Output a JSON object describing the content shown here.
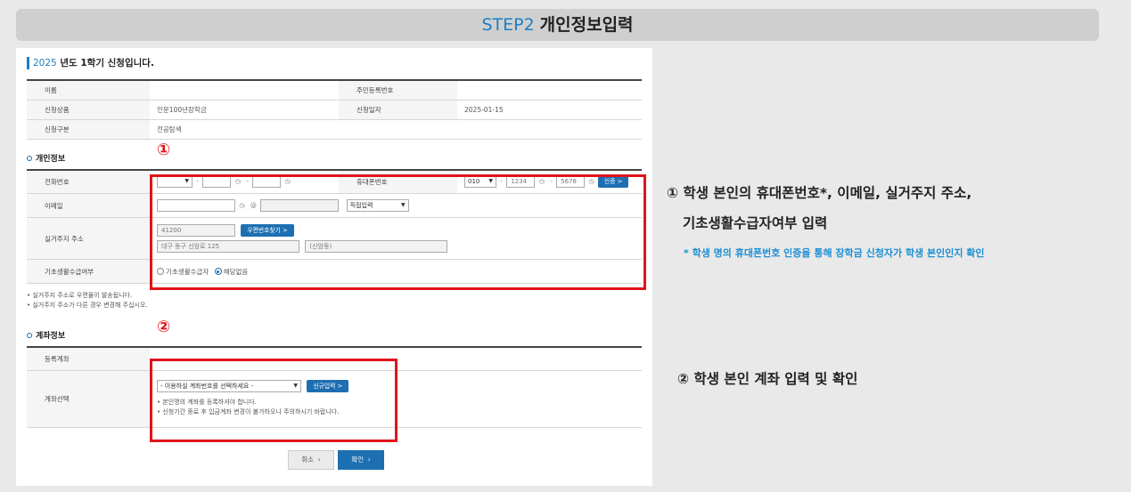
{
  "step": {
    "number": "STEP2",
    "title": "개인정보입력"
  },
  "semester": {
    "year": "2025",
    "text": "년도 1학기 신청입니다."
  },
  "info_table": {
    "name_label": "이름",
    "name_value": "",
    "rrn_label": "주민등록번호",
    "rrn_value": "",
    "product_label": "신청상품",
    "product_value": "인문100년장학금",
    "date_label": "신청일자",
    "date_value": "2025-01-15",
    "type_label": "신청구분",
    "type_value": "전공탐색"
  },
  "personal": {
    "section_title": "개인정보",
    "marker": "①",
    "phone_label": "전화번호",
    "phone_sep": "-",
    "mobile_label": "휴대폰번호",
    "mobile_prefix": "010",
    "mobile_mid": "1234",
    "mobile_last": "5678",
    "verify_button": "인증 >",
    "email_label": "이메일",
    "email_at": "@",
    "email_domain_select": "직접입력",
    "address_label": "실거주지 주소",
    "zipcode": "41200",
    "zip_button": "우편번호찾기 >",
    "address_line1": "대구 동구 신암로 125",
    "address_line2": "(신암동)",
    "basic_label": "기초생활수급여부",
    "basic_option1": "기초생활수급자",
    "basic_option2": "해당없음"
  },
  "notes": {
    "note1": "• 실거주지 주소로 우편물이 발송됩니다.",
    "note2": "• 실거주지 주소가 다른 경우 변경해 주십시오."
  },
  "account": {
    "section_title": "계좌정보",
    "marker": "②",
    "registered_label": "등록계좌",
    "registered_value": "",
    "select_label": "계좌선택",
    "select_placeholder": "- 이용하실 계좌번호를 선택하세요 -",
    "new_button": "신규입력 >",
    "note1": "• 본인명의 계좌를 등록하셔야 합니다.",
    "note2": "• 신청기간 종료 후 입금계좌 변경이 불가하오니 주의하시기 바랍니다."
  },
  "buttons": {
    "cancel": "취소",
    "ok": "확인"
  },
  "annotations": {
    "a1_line1": "① 학생 본인의 휴대폰번호*, 이메일, 실거주지 주소,",
    "a1_line2": "기초생활수급자여부 입력",
    "a1_note": "* 학생 명의 휴대폰번호 인증을 통해 장학금 신청자가 학생 본인인지 확인",
    "a2": "② 학생 본인 계좌 입력 및 확인"
  },
  "colors": {
    "accent": "#1d7fc4",
    "highlight": "#e0151b",
    "button": "#1d6fb2"
  }
}
